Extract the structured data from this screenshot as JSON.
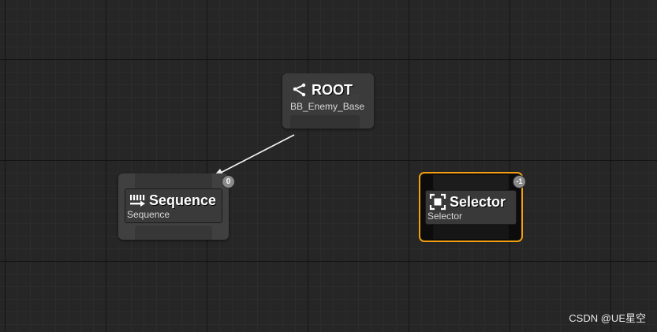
{
  "graph": {
    "nodes": {
      "root": {
        "title": "ROOT",
        "subtitle": "BB_Enemy_Base",
        "icon": "root-branch-icon"
      },
      "sequence": {
        "title": "Sequence",
        "subtitle": "Sequence",
        "icon": "sequence-icon",
        "execution_index": "0"
      },
      "selector": {
        "title": "Selector",
        "subtitle": "Selector",
        "icon": "selector-icon",
        "execution_index": "-1",
        "selected": true
      }
    },
    "wires": [
      {
        "from": "root",
        "to": "sequence",
        "color": "#ffffff"
      }
    ]
  },
  "colors": {
    "canvas_background": "#262626",
    "selection_outline": "#f29e0f",
    "node_title": "#ffffff"
  },
  "watermark": "CSDN @UE星空"
}
